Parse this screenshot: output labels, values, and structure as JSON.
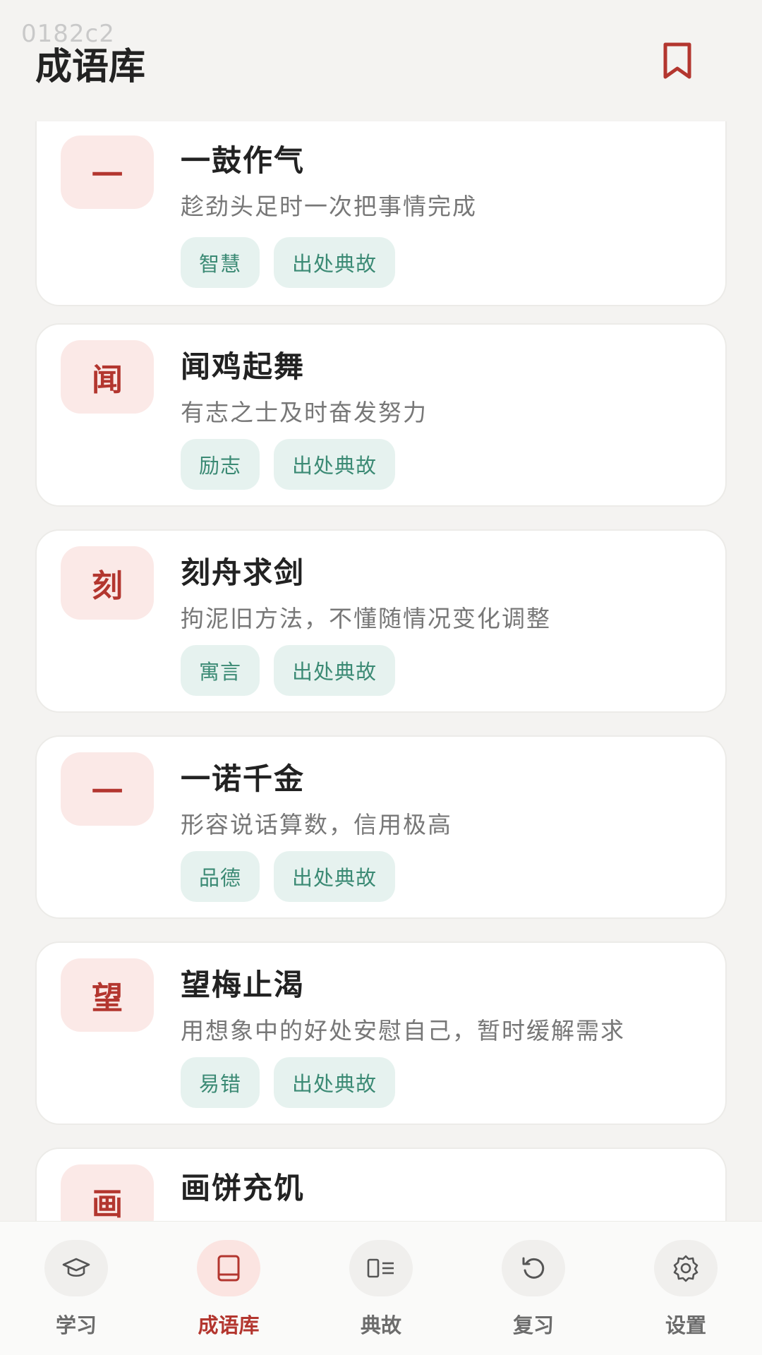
{
  "status": {
    "watermark": "0182c2"
  },
  "header": {
    "title": "成语库",
    "bookmark_icon": "bookmark-icon"
  },
  "cards": [
    {
      "badge": "一",
      "title": "一鼓作气",
      "meaning": "趁劲头足时一次把事情完成",
      "tags": [
        "智慧",
        "出处典故"
      ]
    },
    {
      "badge": "闻",
      "title": "闻鸡起舞",
      "meaning": "有志之士及时奋发努力",
      "tags": [
        "励志",
        "出处典故"
      ]
    },
    {
      "badge": "刻",
      "title": "刻舟求剑",
      "meaning": "拘泥旧方法，不懂随情况变化调整",
      "tags": [
        "寓言",
        "出处典故"
      ]
    },
    {
      "badge": "一",
      "title": "一诺千金",
      "meaning": "形容说话算数，信用极高",
      "tags": [
        "品德",
        "出处典故"
      ]
    },
    {
      "badge": "望",
      "title": "望梅止渴",
      "meaning": "用想象中的好处安慰自己，暂时缓解需求",
      "tags": [
        "易错",
        "出处典故"
      ]
    },
    {
      "badge": "画",
      "title": "画饼充饥",
      "meaning": "",
      "tags": []
    }
  ],
  "nav": {
    "items": [
      {
        "label": "学习",
        "icon": "graduation-cap-icon",
        "active": false
      },
      {
        "label": "成语库",
        "icon": "book-icon",
        "active": true
      },
      {
        "label": "典故",
        "icon": "story-list-icon",
        "active": false
      },
      {
        "label": "复习",
        "icon": "refresh-icon",
        "active": false
      },
      {
        "label": "设置",
        "icon": "gear-icon",
        "active": false
      }
    ]
  },
  "colors": {
    "accent": "#b3362f",
    "tag_text": "#3b8a74",
    "tag_bg": "#e6f2ef",
    "badge_bg": "#fbe9e7"
  }
}
